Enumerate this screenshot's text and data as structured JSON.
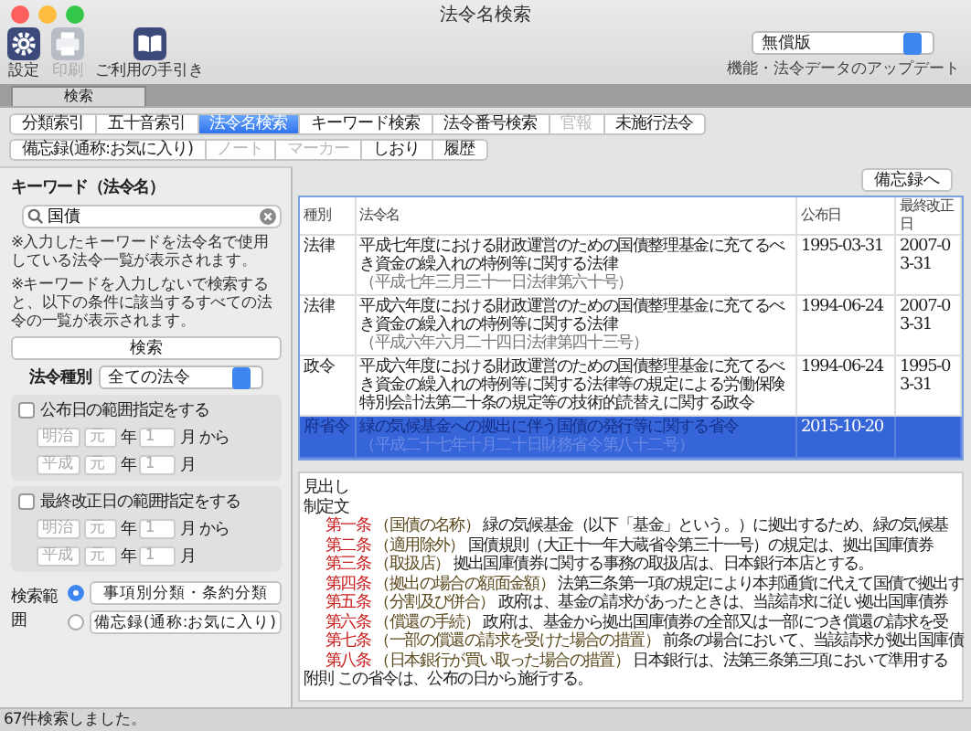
{
  "window": {
    "title": "法令名検索"
  },
  "toolbar": [
    {
      "label": "設定",
      "kind": "gear",
      "disabled": false
    },
    {
      "label": "印刷",
      "kind": "printer",
      "disabled": true
    },
    {
      "label": "ご利用の手引き",
      "kind": "book",
      "disabled": false
    }
  ],
  "edition_select": {
    "value": "無償版"
  },
  "update_link": "機能・法令データのアップデート",
  "main_tabs": [
    {
      "label": "検索",
      "selected": true
    }
  ],
  "search_modes": [
    {
      "label": "分類索引",
      "selected": false,
      "disabled": false
    },
    {
      "label": "五十音索引",
      "selected": false,
      "disabled": false
    },
    {
      "label": "法令名検索",
      "selected": true,
      "disabled": false
    },
    {
      "label": "キーワード検索",
      "selected": false,
      "disabled": false
    },
    {
      "label": "法令番号検索",
      "selected": false,
      "disabled": false
    },
    {
      "label": "官報",
      "selected": false,
      "disabled": true
    },
    {
      "label": "未施行法令",
      "selected": false,
      "disabled": false
    }
  ],
  "sub_modes": [
    {
      "label": "備忘録(通称:お気に入り)",
      "selected": false,
      "disabled": false
    },
    {
      "label": "ノート",
      "selected": false,
      "disabled": true
    },
    {
      "label": "マーカー",
      "selected": false,
      "disabled": true
    },
    {
      "label": "しおり",
      "selected": false,
      "disabled": false
    },
    {
      "label": "履歴",
      "selected": false,
      "disabled": false
    }
  ],
  "left": {
    "keyword_label": "キーワード（法令名）",
    "search_field": {
      "value": "国債"
    },
    "notes": [
      "※入力したキーワードを法令名で使用している法令一覧が表示されます。",
      "※キーワードを入力しないで検索すると、以下の条件に該当するすべての法令の一覧が表示されます。"
    ],
    "search_button": "検索",
    "type_label": "法令種別",
    "type_select": "全ての法令",
    "ranges": [
      {
        "label": "公布日の範囲指定をする",
        "checked": false,
        "rows": [
          {
            "era": "明治",
            "year": "元",
            "year_unit": "年",
            "month": "1",
            "month_unit": "月",
            "suffix": "から"
          },
          {
            "era": "平成",
            "year": "元",
            "year_unit": "年",
            "month": "1",
            "month_unit": "月"
          }
        ]
      },
      {
        "label": "最終改正日の範囲指定をする",
        "checked": false,
        "rows": [
          {
            "era": "明治",
            "year": "元",
            "year_unit": "年",
            "month": "1",
            "month_unit": "月",
            "suffix": "から"
          },
          {
            "era": "平成",
            "year": "元",
            "year_unit": "年",
            "month": "1",
            "month_unit": "月"
          }
        ]
      }
    ],
    "scope_label": "検索範囲",
    "scope_options": [
      {
        "label": "事項別分類・条約分類",
        "selected": true
      },
      {
        "label": "備忘録(通称:お気に入り)",
        "selected": false
      }
    ]
  },
  "memo_button": "備忘録へ",
  "table": {
    "columns": [
      "種別",
      "法令名",
      "公布日",
      "最終改正日"
    ],
    "rows": [
      {
        "type": "法律",
        "name": "平成七年度における財政運営のための国債整理基金に充てるべき資金の繰入れの特例等に関する法律",
        "citation": "（平成七年三月三十一日法律第六十号）",
        "promulgated": "1995-03-31",
        "last_revised": "2007-03-31",
        "selected": false
      },
      {
        "type": "法律",
        "name": "平成六年度における財政運営のための国債整理基金に充てるべき資金の繰入れの特例等に関する法律",
        "citation": "（平成六年六月二十四日法律第四十三号）",
        "promulgated": "1994-06-24",
        "last_revised": "2007-03-31",
        "selected": false
      },
      {
        "type": "政令",
        "name": "平成六年度における財政運営のための国債整理基金に充てるべき資金の繰入れの特例等に関する法律等の規定による労働保険特別会計法第二十条の規定等の技術的読替えに関する政令",
        "promulgated": "1994-06-24",
        "last_revised": "1995-03-31",
        "selected": false
      },
      {
        "type": "府省令",
        "name": "緑の気候基金への拠出に伴う国債の発行等に関する省令",
        "citation": "（平成二十七年十月二十日財務省令第八十二号）",
        "promulgated": "2015-10-20",
        "selected": true
      }
    ]
  },
  "detail": {
    "heading_label": "見出し",
    "preamble_label": "制定文",
    "articles": [
      {
        "number": "第一条",
        "heading": "（国債の名称）",
        "text": "緑の気候基金（以下「基金」という。）に拠出するため、緑の気候基"
      },
      {
        "number": "第二条",
        "heading": "（適用除外）",
        "text": "国債規則（大正十一年大蔵省令第三十一号）の規定は、拠出国庫債券"
      },
      {
        "number": "第三条",
        "heading": "（取扱店）",
        "text": "拠出国庫債券に関する事務の取扱店は、日本銀行本店とする。"
      },
      {
        "number": "第四条",
        "heading": "（拠出の場合の額面金額）",
        "text": "法第三条第一項の規定により本邦通貨に代えて国債で拠出す"
      },
      {
        "number": "第五条",
        "heading": "（分割及び併合）",
        "text": "政府は、基金の請求があったときは、当該請求に従い拠出国庫債券"
      },
      {
        "number": "第六条",
        "heading": "（償還の手続）",
        "text": "政府は、基金から拠出国庫債券の全部又は一部につき償還の請求を受"
      },
      {
        "number": "第七条",
        "heading": "（一部の償還の請求を受けた場合の措置）",
        "text": "前条の場合において、当該請求が拠出国庫債"
      },
      {
        "number": "第八条",
        "heading": "（日本銀行が買い取った場合の措置）",
        "text": "日本銀行は、法第三条第三項において準用する"
      }
    ],
    "supplementary": {
      "label": "附則",
      "text": "この省令は、公布の日から施行する。"
    }
  },
  "status_bar": "67件検索しました。"
}
